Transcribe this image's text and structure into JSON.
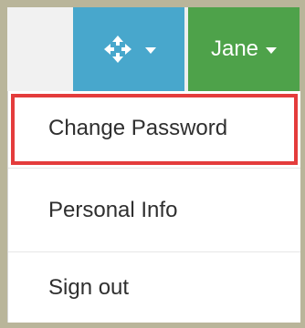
{
  "navbar": {
    "settings_icon": "recycle-settings-icon",
    "user_button_label": "Jane",
    "colors": {
      "icon_button_bg": "#48a7cc",
      "user_button_bg": "#4ea24a"
    }
  },
  "dropdown": {
    "items": [
      {
        "label": "Change Password",
        "highlighted": true
      },
      {
        "label": "Personal Info"
      },
      {
        "label": "Sign out"
      }
    ],
    "highlight_color": "#e43c3c"
  }
}
